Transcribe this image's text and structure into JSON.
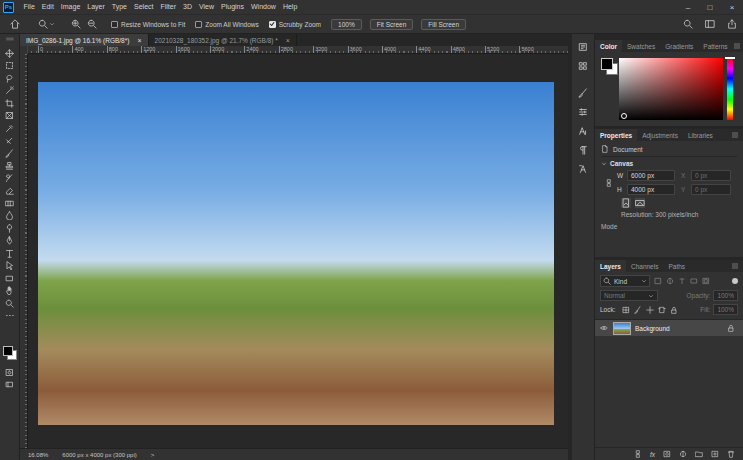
{
  "app": {
    "logo": "Ps"
  },
  "menu": [
    "File",
    "Edit",
    "Image",
    "Layer",
    "Type",
    "Select",
    "Filter",
    "3D",
    "View",
    "Plugins",
    "Window",
    "Help"
  ],
  "window_controls": [
    "–",
    "□",
    "×"
  ],
  "options_bar": {
    "checkboxes": [
      {
        "label": "Resize Windows to Fit",
        "checked": false
      },
      {
        "label": "Zoom All Windows",
        "checked": false
      },
      {
        "label": "Scrubby Zoom",
        "checked": true
      }
    ],
    "buttons": [
      "100%",
      "Fit Screen",
      "Fill Screen"
    ]
  },
  "doc_tabs": [
    {
      "label": "IMG_0286-1.jpg @ 16.1% (RGB/8*)",
      "close": "×",
      "selected": true
    },
    {
      "label": "20210328_180352.jpg @ 21.7% (RGB/8) *",
      "close": "×",
      "selected": false
    }
  ],
  "ruler": {
    "labels": [
      "0",
      "400",
      "800",
      "1200",
      "1600",
      "2000",
      "2400",
      "2800",
      "3200",
      "3600",
      "4000",
      "4400",
      "4800",
      "5200",
      "5600"
    ]
  },
  "status_bar": {
    "zoom": "16.08%",
    "info": "6000 px x 4000 px (300 ppi)",
    "arrow": ">"
  },
  "color_panel": {
    "tabs": [
      {
        "label": "Color",
        "selected": true
      },
      {
        "label": "Swatches",
        "selected": false
      },
      {
        "label": "Gradients",
        "selected": false
      },
      {
        "label": "Patterns",
        "selected": false
      }
    ]
  },
  "properties": {
    "tabs": [
      {
        "label": "Properties",
        "selected": true
      },
      {
        "label": "Adjustments",
        "selected": false
      },
      {
        "label": "Libraries",
        "selected": false
      }
    ],
    "document": "Document",
    "canvas_title": "Canvas",
    "fields": [
      {
        "label": "W",
        "value": "6000 px",
        "disabled": false
      },
      {
        "label": "X",
        "value": "0 px",
        "disabled": true
      },
      {
        "label": "H",
        "value": "4000 px",
        "disabled": false
      },
      {
        "label": "Y",
        "value": "0 px",
        "disabled": true
      }
    ],
    "resolution": "Resolution: 300 pixels/inch",
    "mode": "Mode"
  },
  "layers": {
    "tabs": [
      {
        "label": "Layers",
        "selected": true
      },
      {
        "label": "Channels",
        "selected": false
      },
      {
        "label": "Paths",
        "selected": false
      }
    ],
    "filter": "Kind",
    "blend": {
      "value": "Normal",
      "disabled": true
    },
    "opacity": {
      "label": "Opacity:",
      "value": "100%",
      "disabled": true
    },
    "lock_label": "Lock:",
    "fill": {
      "label": "Fill:",
      "value": "100%",
      "disabled": true
    },
    "items": [
      {
        "name": "Background",
        "visible": true,
        "locked": true,
        "selected": true
      }
    ],
    "footer_label": "fx"
  }
}
